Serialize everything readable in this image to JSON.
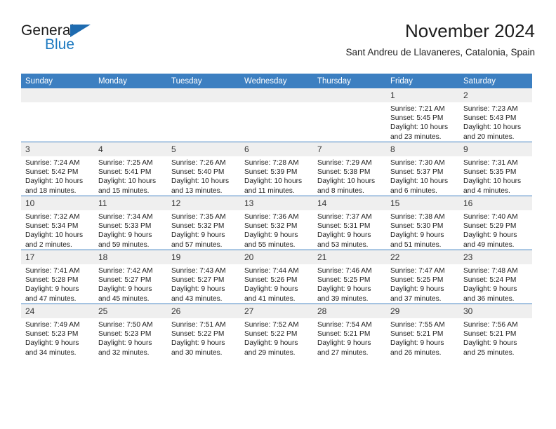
{
  "brand": {
    "line1": "General",
    "line2": "Blue",
    "triangle_icon": "blue-triangle-icon",
    "accent_color": "#1e7ac0",
    "text_color": "#1d1d1d"
  },
  "header": {
    "title": "November 2024",
    "subtitle": "Sant Andreu de Llavaneres, Catalonia, Spain"
  },
  "calendar": {
    "header_bg": "#3c7fc1",
    "daynum_bg": "#efefef",
    "weekdays": [
      "Sunday",
      "Monday",
      "Tuesday",
      "Wednesday",
      "Thursday",
      "Friday",
      "Saturday"
    ],
    "labels": {
      "sunrise": "Sunrise:",
      "sunset": "Sunset:",
      "daylight": "Daylight:"
    },
    "weeks": [
      [
        {
          "day": "",
          "empty": true
        },
        {
          "day": "",
          "empty": true
        },
        {
          "day": "",
          "empty": true
        },
        {
          "day": "",
          "empty": true
        },
        {
          "day": "",
          "empty": true
        },
        {
          "day": "1",
          "sunrise": "Sunrise: 7:21 AM",
          "sunset": "Sunset: 5:45 PM",
          "daylight_line1": "Daylight: 10 hours",
          "daylight_line2": "and 23 minutes."
        },
        {
          "day": "2",
          "sunrise": "Sunrise: 7:23 AM",
          "sunset": "Sunset: 5:43 PM",
          "daylight_line1": "Daylight: 10 hours",
          "daylight_line2": "and 20 minutes."
        }
      ],
      [
        {
          "day": "3",
          "sunrise": "Sunrise: 7:24 AM",
          "sunset": "Sunset: 5:42 PM",
          "daylight_line1": "Daylight: 10 hours",
          "daylight_line2": "and 18 minutes."
        },
        {
          "day": "4",
          "sunrise": "Sunrise: 7:25 AM",
          "sunset": "Sunset: 5:41 PM",
          "daylight_line1": "Daylight: 10 hours",
          "daylight_line2": "and 15 minutes."
        },
        {
          "day": "5",
          "sunrise": "Sunrise: 7:26 AM",
          "sunset": "Sunset: 5:40 PM",
          "daylight_line1": "Daylight: 10 hours",
          "daylight_line2": "and 13 minutes."
        },
        {
          "day": "6",
          "sunrise": "Sunrise: 7:28 AM",
          "sunset": "Sunset: 5:39 PM",
          "daylight_line1": "Daylight: 10 hours",
          "daylight_line2": "and 11 minutes."
        },
        {
          "day": "7",
          "sunrise": "Sunrise: 7:29 AM",
          "sunset": "Sunset: 5:38 PM",
          "daylight_line1": "Daylight: 10 hours",
          "daylight_line2": "and 8 minutes."
        },
        {
          "day": "8",
          "sunrise": "Sunrise: 7:30 AM",
          "sunset": "Sunset: 5:37 PM",
          "daylight_line1": "Daylight: 10 hours",
          "daylight_line2": "and 6 minutes."
        },
        {
          "day": "9",
          "sunrise": "Sunrise: 7:31 AM",
          "sunset": "Sunset: 5:35 PM",
          "daylight_line1": "Daylight: 10 hours",
          "daylight_line2": "and 4 minutes."
        }
      ],
      [
        {
          "day": "10",
          "sunrise": "Sunrise: 7:32 AM",
          "sunset": "Sunset: 5:34 PM",
          "daylight_line1": "Daylight: 10 hours",
          "daylight_line2": "and 2 minutes."
        },
        {
          "day": "11",
          "sunrise": "Sunrise: 7:34 AM",
          "sunset": "Sunset: 5:33 PM",
          "daylight_line1": "Daylight: 9 hours",
          "daylight_line2": "and 59 minutes."
        },
        {
          "day": "12",
          "sunrise": "Sunrise: 7:35 AM",
          "sunset": "Sunset: 5:32 PM",
          "daylight_line1": "Daylight: 9 hours",
          "daylight_line2": "and 57 minutes."
        },
        {
          "day": "13",
          "sunrise": "Sunrise: 7:36 AM",
          "sunset": "Sunset: 5:32 PM",
          "daylight_line1": "Daylight: 9 hours",
          "daylight_line2": "and 55 minutes."
        },
        {
          "day": "14",
          "sunrise": "Sunrise: 7:37 AM",
          "sunset": "Sunset: 5:31 PM",
          "daylight_line1": "Daylight: 9 hours",
          "daylight_line2": "and 53 minutes."
        },
        {
          "day": "15",
          "sunrise": "Sunrise: 7:38 AM",
          "sunset": "Sunset: 5:30 PM",
          "daylight_line1": "Daylight: 9 hours",
          "daylight_line2": "and 51 minutes."
        },
        {
          "day": "16",
          "sunrise": "Sunrise: 7:40 AM",
          "sunset": "Sunset: 5:29 PM",
          "daylight_line1": "Daylight: 9 hours",
          "daylight_line2": "and 49 minutes."
        }
      ],
      [
        {
          "day": "17",
          "sunrise": "Sunrise: 7:41 AM",
          "sunset": "Sunset: 5:28 PM",
          "daylight_line1": "Daylight: 9 hours",
          "daylight_line2": "and 47 minutes."
        },
        {
          "day": "18",
          "sunrise": "Sunrise: 7:42 AM",
          "sunset": "Sunset: 5:27 PM",
          "daylight_line1": "Daylight: 9 hours",
          "daylight_line2": "and 45 minutes."
        },
        {
          "day": "19",
          "sunrise": "Sunrise: 7:43 AM",
          "sunset": "Sunset: 5:27 PM",
          "daylight_line1": "Daylight: 9 hours",
          "daylight_line2": "and 43 minutes."
        },
        {
          "day": "20",
          "sunrise": "Sunrise: 7:44 AM",
          "sunset": "Sunset: 5:26 PM",
          "daylight_line1": "Daylight: 9 hours",
          "daylight_line2": "and 41 minutes."
        },
        {
          "day": "21",
          "sunrise": "Sunrise: 7:46 AM",
          "sunset": "Sunset: 5:25 PM",
          "daylight_line1": "Daylight: 9 hours",
          "daylight_line2": "and 39 minutes."
        },
        {
          "day": "22",
          "sunrise": "Sunrise: 7:47 AM",
          "sunset": "Sunset: 5:25 PM",
          "daylight_line1": "Daylight: 9 hours",
          "daylight_line2": "and 37 minutes."
        },
        {
          "day": "23",
          "sunrise": "Sunrise: 7:48 AM",
          "sunset": "Sunset: 5:24 PM",
          "daylight_line1": "Daylight: 9 hours",
          "daylight_line2": "and 36 minutes."
        }
      ],
      [
        {
          "day": "24",
          "sunrise": "Sunrise: 7:49 AM",
          "sunset": "Sunset: 5:23 PM",
          "daylight_line1": "Daylight: 9 hours",
          "daylight_line2": "and 34 minutes."
        },
        {
          "day": "25",
          "sunrise": "Sunrise: 7:50 AM",
          "sunset": "Sunset: 5:23 PM",
          "daylight_line1": "Daylight: 9 hours",
          "daylight_line2": "and 32 minutes."
        },
        {
          "day": "26",
          "sunrise": "Sunrise: 7:51 AM",
          "sunset": "Sunset: 5:22 PM",
          "daylight_line1": "Daylight: 9 hours",
          "daylight_line2": "and 30 minutes."
        },
        {
          "day": "27",
          "sunrise": "Sunrise: 7:52 AM",
          "sunset": "Sunset: 5:22 PM",
          "daylight_line1": "Daylight: 9 hours",
          "daylight_line2": "and 29 minutes."
        },
        {
          "day": "28",
          "sunrise": "Sunrise: 7:54 AM",
          "sunset": "Sunset: 5:21 PM",
          "daylight_line1": "Daylight: 9 hours",
          "daylight_line2": "and 27 minutes."
        },
        {
          "day": "29",
          "sunrise": "Sunrise: 7:55 AM",
          "sunset": "Sunset: 5:21 PM",
          "daylight_line1": "Daylight: 9 hours",
          "daylight_line2": "and 26 minutes."
        },
        {
          "day": "30",
          "sunrise": "Sunrise: 7:56 AM",
          "sunset": "Sunset: 5:21 PM",
          "daylight_line1": "Daylight: 9 hours",
          "daylight_line2": "and 25 minutes."
        }
      ]
    ]
  }
}
